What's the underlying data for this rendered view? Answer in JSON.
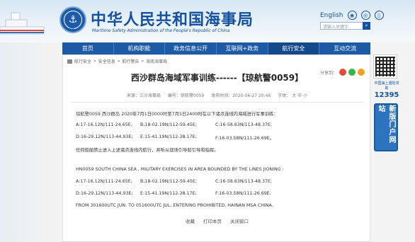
{
  "header": {
    "site_name_cn": "中华人民共和国海事局",
    "site_name_en": "Maritime Safety Administration of the People's Republic of China",
    "emblem_label": "MSA",
    "lang_label": "English",
    "search_placeholder": "请输入关键字"
  },
  "nav": {
    "items": [
      "首页",
      "机构职能",
      "政务信息公开",
      "互联网+政务",
      "航行安全",
      "互动交流"
    ]
  },
  "breadcrumb": [
    "航行安全",
    "安全信息",
    "航行警告",
    "海南海事局"
  ],
  "article": {
    "title": "西沙群岛海域军事训练------【琼航警0059】",
    "source": "来源：三沙海事局",
    "doc_no": "编号：琼航警0059",
    "publish_time": "发布时间：2020-06-27 20:46",
    "font_size_label": "字体：",
    "font_big": "大",
    "font_mid": "中",
    "font_small": "小",
    "share_label": "分享到：",
    "cn_intro": "琼航警0059 西沙群岛 2020年7月1日0000时至7月5日2400时在以下诸点连线内海域进行军事训练：",
    "cn_coords": [
      [
        "A:17-16.12N/111-24.65E;",
        "B:18-02.19N/112-59.45E;",
        "C:16-58.63N/113-48.37E;"
      ],
      [
        "D:16-29.12N/113-44.93E;",
        "E:15-41.19N/112-38.17E;",
        "F:16-03.58N/111-26.69E。"
      ]
    ],
    "cn_notice": "任何船舶禁止进入上述诸点连线内航行，并听从现场引导船引导和指挥。",
    "en_intro": "HN0059  SOUTH CHINA SEA , MILITARY EXERCISES IN AREA BOUNDED BY THE LINES JIONING :",
    "en_coords": [
      [
        "A:17-16.12N/111-24.65E;",
        "B:18-02.19N/112-59.45E;",
        "C:16-58.63N/113-48.37E;"
      ],
      [
        "D:16-29.12N/113-44.93E;",
        "E:15-41.19N/112-38.17E;",
        "F:16-03.58N/111-26.69E."
      ]
    ],
    "en_notice": " FROM 301600UTC JUN. TO 051600UTC JUL, ENTERING PROHIBITED. HAINAN MSA CHINA.",
    "footer_links": [
      "收藏",
      "打印本页",
      "关闭窗口"
    ]
  },
  "side": {
    "hotline_label": "中国海上遇险求助",
    "hotline_number": "12395",
    "portal_label": "新版门户网站"
  },
  "colors": {
    "brand": "#1452a0",
    "nav_bg": "#1c5aa6"
  }
}
